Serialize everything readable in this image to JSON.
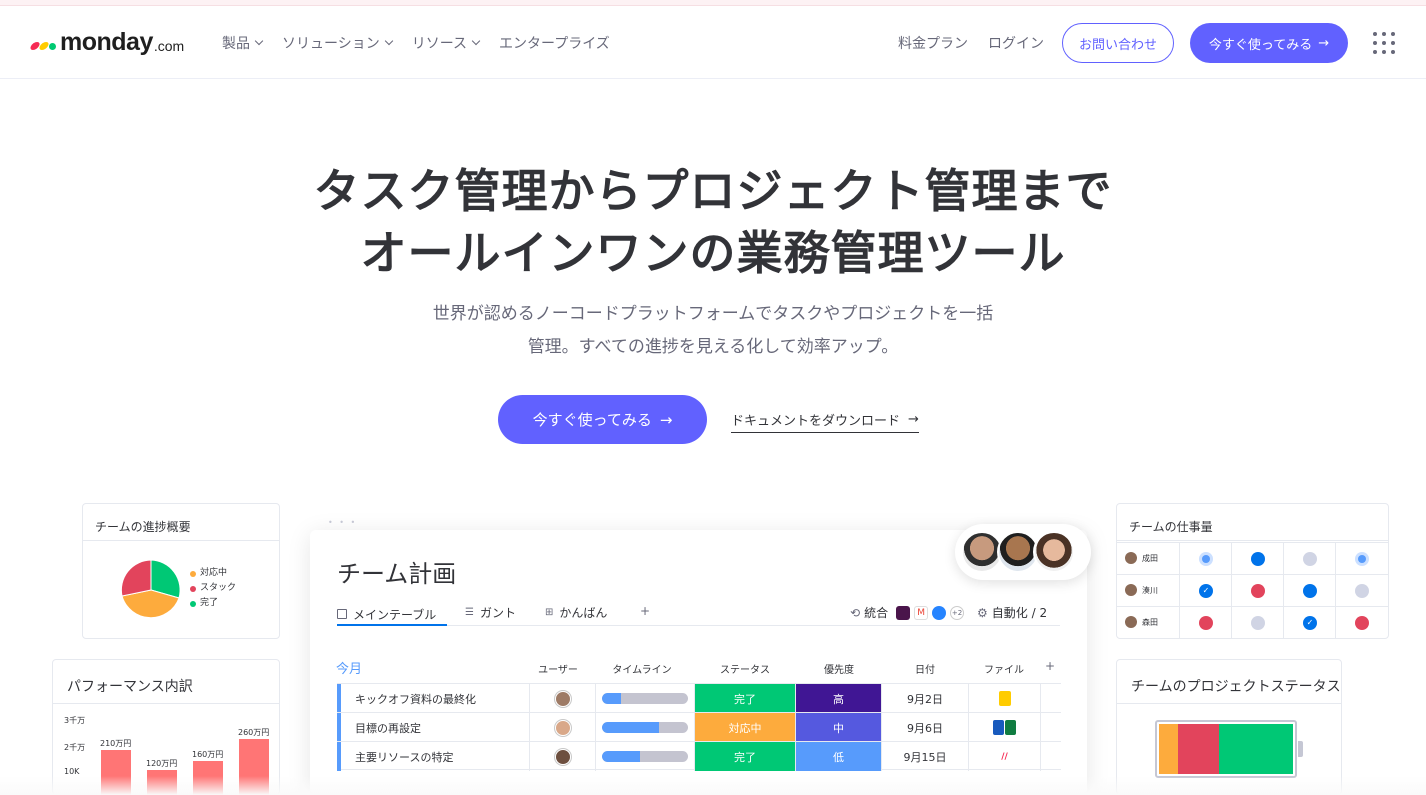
{
  "header": {
    "logo_text": "monday",
    "logo_domain": ".com",
    "nav": [
      {
        "label": "製品",
        "dropdown": true
      },
      {
        "label": "ソリューション",
        "dropdown": true
      },
      {
        "label": "リソース",
        "dropdown": true
      },
      {
        "label": "エンタープライズ",
        "dropdown": false
      }
    ],
    "pricing": "料金プラン",
    "login": "ログイン",
    "contact": "お問い合わせ",
    "try_now": "今すぐ使ってみる",
    "arrow": "→",
    "apps_icon": "grid-icon"
  },
  "hero": {
    "title_line1": "タスク管理からプロジェクト管理まで",
    "title_line2": "オールインワンの業務管理ツール",
    "subtitle_line1": "世界が認めるノーコードプラットフォームでタスクやプロジェクトを一括",
    "subtitle_line2": "管理。すべての進捗を見える化して効率アップ。",
    "cta": "今すぐ使ってみる",
    "download": "ドキュメントをダウンロード"
  },
  "progress_card": {
    "title": "チームの進捗概要",
    "legend": [
      {
        "label": "対応中",
        "color": "#fdab3d"
      },
      {
        "label": "スタック",
        "color": "#e2445c"
      },
      {
        "label": "完了",
        "color": "#00c875"
      }
    ]
  },
  "performance_card": {
    "title": "パフォーマンス内訳",
    "y_ticks": [
      "3千万",
      "2千万",
      "10K"
    ],
    "bars": [
      {
        "label": "210万円",
        "value": 210
      },
      {
        "label": "120万円",
        "value": 120
      },
      {
        "label": "160万円",
        "value": 160
      },
      {
        "label": "260万円",
        "value": 260
      }
    ]
  },
  "board": {
    "title": "チーム計画",
    "tabs": [
      "メインテーブル",
      "ガント",
      "かんばん"
    ],
    "add_tab": "+",
    "integrations": "統合",
    "integrations_more": "+2",
    "automation": "自動化 / 2",
    "group": "今月",
    "columns": [
      "ユーザー",
      "タイムライン",
      "ステータス",
      "優先度",
      "日付",
      "ファイル"
    ],
    "add_column": "+",
    "rows": [
      {
        "name": "キックオフ資料の最終化",
        "timeline": 0.22,
        "status": "完了",
        "status_color": "#00c875",
        "priority": "高",
        "priority_color": "#401694",
        "date": "9月2日"
      },
      {
        "name": "目標の再設定",
        "timeline": 0.66,
        "status": "対応中",
        "status_color": "#fdab3d",
        "priority": "中",
        "priority_color": "#5559df",
        "date": "9月6日"
      },
      {
        "name": "主要リソースの特定",
        "timeline": 0.44,
        "status": "完了",
        "status_color": "#00c875",
        "priority": "低",
        "priority_color": "#579bfc",
        "date": "9月15日"
      }
    ]
  },
  "workload_card": {
    "title": "チームの仕事量",
    "people": [
      {
        "name": "成田",
        "dots": [
          "#579bfc",
          "#0073ea",
          "#d0d4e4",
          "#579bfc"
        ]
      },
      {
        "name": "湊川",
        "dots": [
          "#0073ea",
          "#e2445c",
          "#0073ea",
          "#d0d4e4"
        ]
      },
      {
        "name": "森田",
        "dots": [
          "#e2445c",
          "#d0d4e4",
          "#0073ea",
          "#e2445c"
        ]
      }
    ]
  },
  "status_card": {
    "title": "チームのプロジェクトステータス",
    "segments": [
      {
        "color": "#fdab3d",
        "share": 0.14
      },
      {
        "color": "#e2445c",
        "share": 0.31
      },
      {
        "color": "#00c875",
        "share": 0.55
      }
    ]
  }
}
